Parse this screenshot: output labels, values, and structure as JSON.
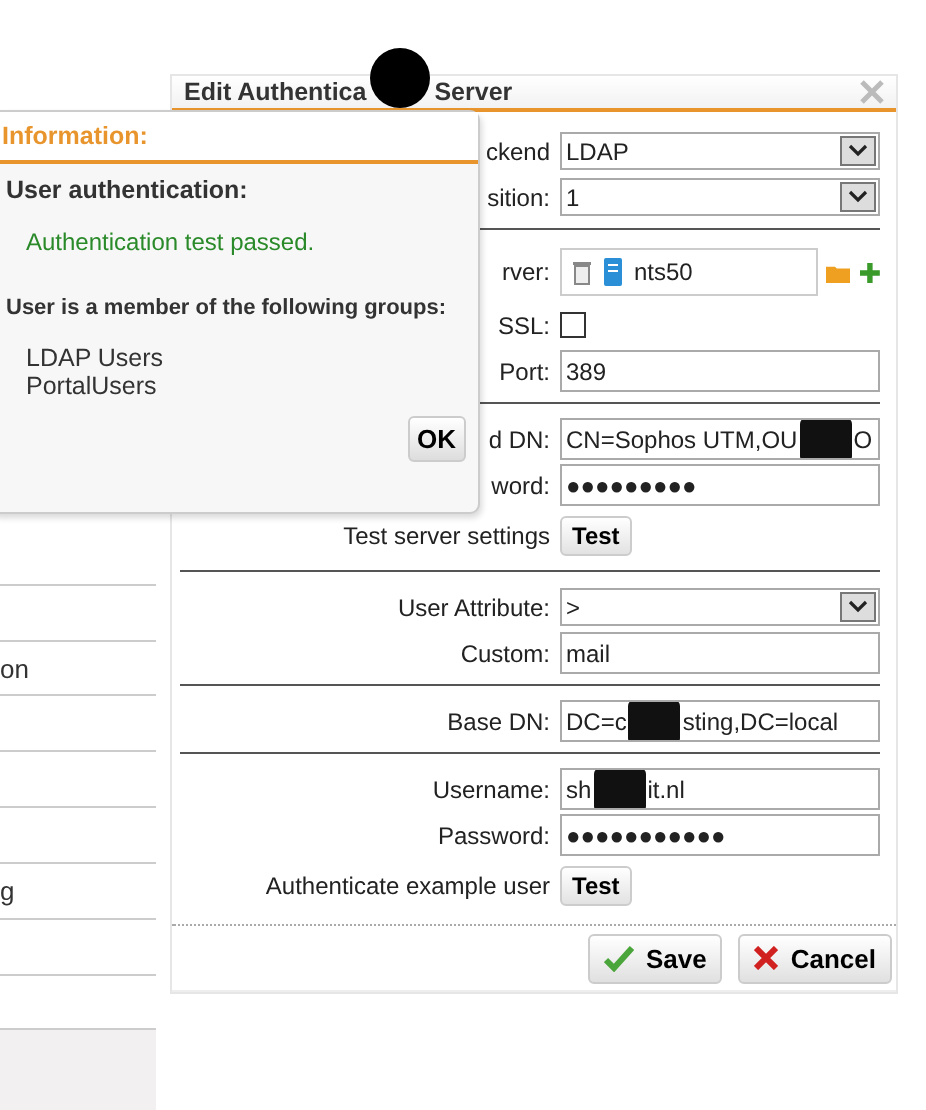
{
  "sidebar": {
    "rows": [
      {
        "kind": "blank"
      },
      {
        "kind": "blank"
      },
      {
        "kind": "text",
        "label": "on"
      },
      {
        "kind": "blank"
      },
      {
        "kind": "blank"
      },
      {
        "kind": "blank"
      },
      {
        "kind": "text",
        "label": "g"
      },
      {
        "kind": "blank"
      },
      {
        "kind": "blank"
      }
    ]
  },
  "dialog": {
    "title_segments": [
      "Edit Authentica",
      "Server"
    ],
    "rows": [
      {
        "kind": "select",
        "label": "ckend",
        "value": "LDAP"
      },
      {
        "kind": "select",
        "label": "sition:",
        "value": "1"
      },
      {
        "kind": "divider"
      },
      {
        "kind": "server",
        "label": "rver:",
        "value": "nts50"
      },
      {
        "kind": "checkbox",
        "label": "SSL:",
        "checked": false
      },
      {
        "kind": "text",
        "label": "Port:",
        "segments": [
          "389"
        ]
      },
      {
        "kind": "divider"
      },
      {
        "kind": "text",
        "label": "d DN:",
        "segments": [
          "CN=Sophos UTM,OU",
          "O"
        ]
      },
      {
        "kind": "password",
        "label": "word:",
        "value": "●●●●●●●●●"
      },
      {
        "kind": "button",
        "label": "Test server settings",
        "button": "Test"
      },
      {
        "kind": "divider"
      },
      {
        "kind": "select",
        "label": "User Attribute:",
        "value": ">"
      },
      {
        "kind": "text",
        "label": "Custom:",
        "segments": [
          "mail"
        ]
      },
      {
        "kind": "divider"
      },
      {
        "kind": "text",
        "label": "Base DN:",
        "segments": [
          "DC=c",
          "sting,DC=local"
        ]
      },
      {
        "kind": "divider"
      },
      {
        "kind": "text",
        "label": "Username:",
        "segments": [
          "sh",
          "it.nl"
        ]
      },
      {
        "kind": "password",
        "label": "Password:",
        "value": "●●●●●●●●●●●"
      },
      {
        "kind": "button",
        "label": "Authenticate example user",
        "button": "Test"
      }
    ],
    "buttons": [
      {
        "kind": "save",
        "label": "Save"
      },
      {
        "kind": "cancel",
        "label": "Cancel"
      }
    ]
  },
  "popup": {
    "title": "Information:",
    "heading": "User authentication:",
    "message": "Authentication test passed.",
    "groups_heading": "User is a member of the following groups:",
    "groups": [
      "LDAP Users",
      "PortalUsers"
    ],
    "button": "OK"
  }
}
